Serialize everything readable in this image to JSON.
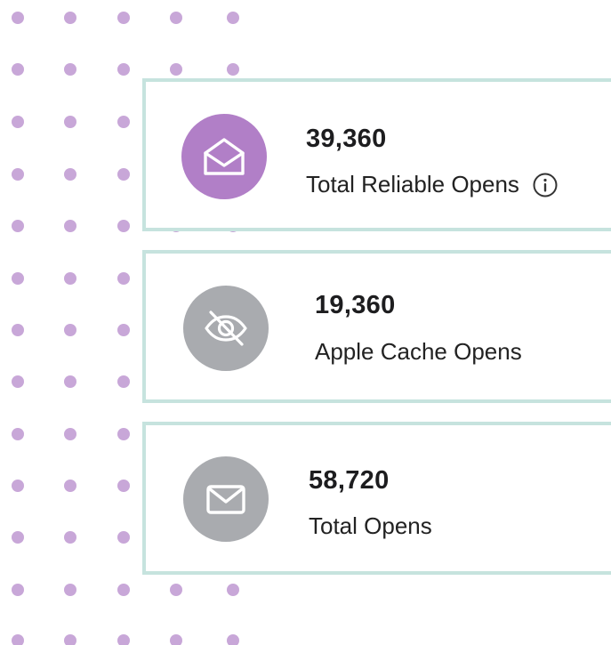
{
  "colors": {
    "dot": "#c8a7d8",
    "card_border": "#c6e3de",
    "icon_purple": "#b17fc7",
    "icon_gray": "#a9abaf"
  },
  "stats": [
    {
      "value": "39,360",
      "label": "Total Reliable Opens",
      "icon": "open-envelope-icon",
      "icon_color": "#b17fc7",
      "has_info": true
    },
    {
      "value": "19,360",
      "label": "Apple Cache Opens",
      "icon": "eye-slash-icon",
      "icon_color": "#a9abaf",
      "has_info": false
    },
    {
      "value": "58,720",
      "label": "Total Opens",
      "icon": "envelope-icon",
      "icon_color": "#a9abaf",
      "has_info": false
    }
  ]
}
